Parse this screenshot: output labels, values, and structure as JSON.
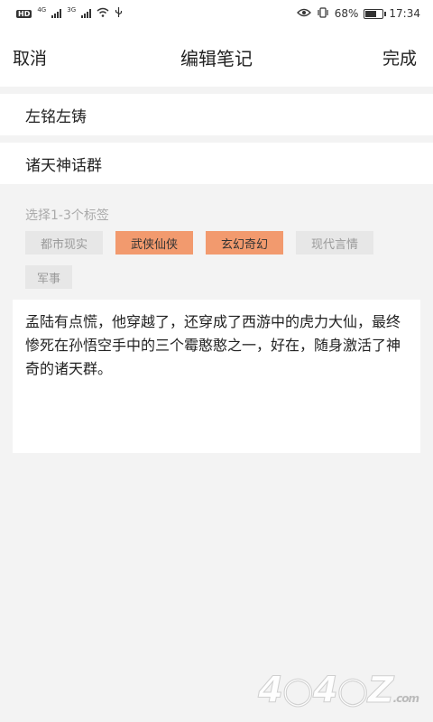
{
  "status_bar": {
    "hd": "HD",
    "net1": "4G",
    "net2": "3G",
    "battery_percent": "68%",
    "battery_level": 0.68,
    "time": "17:34"
  },
  "header": {
    "cancel_label": "取消",
    "title": "编辑笔记",
    "done_label": "完成"
  },
  "form": {
    "title_value": "左铭左铸",
    "subtitle_value": "诸天神话群"
  },
  "tags": {
    "hint": "选择1-3个标签",
    "items": [
      {
        "label": "都市现实",
        "selected": false
      },
      {
        "label": "武侠仙侠",
        "selected": true
      },
      {
        "label": "玄幻奇幻",
        "selected": true
      },
      {
        "label": "现代言情",
        "selected": false
      },
      {
        "label": "军事",
        "selected": false
      }
    ]
  },
  "note": {
    "text": "孟陆有点慌，他穿越了，还穿成了西游中的虎力大仙，最终惨死在孙悟空手中的三个霉憨憨之一，好在，随身激活了神奇的诸天群。"
  },
  "watermark": {
    "text": "4○4○Z",
    "suffix": ".com"
  },
  "colors": {
    "accent": "#f29a6e",
    "background": "#f3f3f3"
  }
}
